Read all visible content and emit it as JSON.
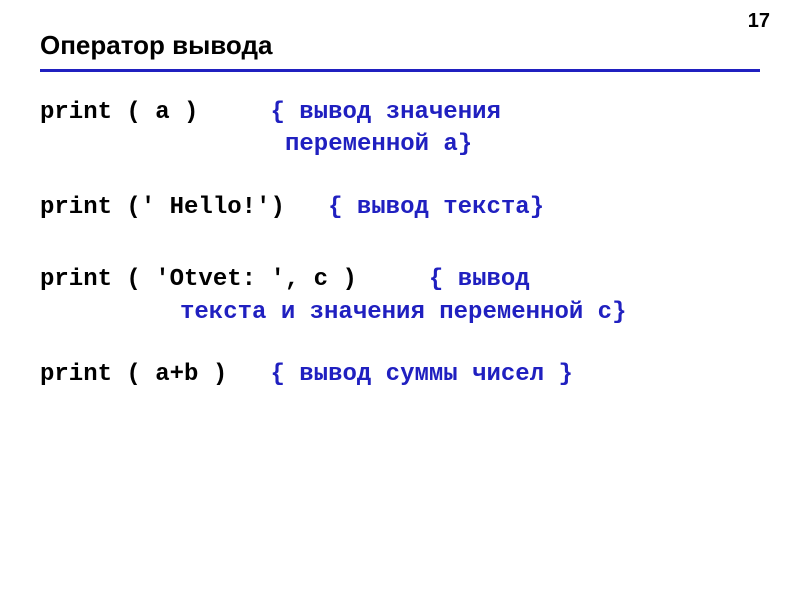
{
  "page_number": "17",
  "title": "Оператор вывода",
  "examples": [
    {
      "code": "print ( a )",
      "comment_line1": "{ вывод значения",
      "comment_line2": "переменной a}"
    },
    {
      "code": "print (' Hello!')",
      "comment": "{ вывод текста}"
    },
    {
      "code": "print ( 'Otvet: ', c )",
      "comment_line1": "{ вывод",
      "comment_line2": "текста и значения переменной c}"
    },
    {
      "code": "print ( a+b )",
      "comment": "{ вывод суммы чисел }"
    }
  ]
}
